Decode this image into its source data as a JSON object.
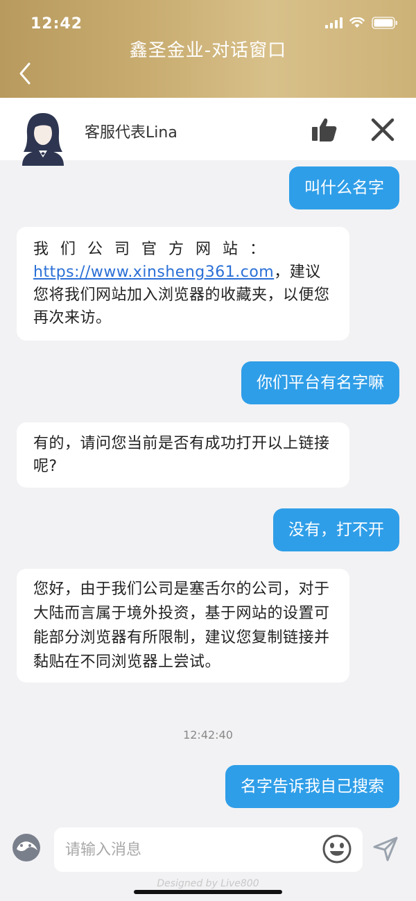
{
  "status_bar": {
    "time": "12:42"
  },
  "header": {
    "title": "鑫圣金业-对话窗口"
  },
  "agent": {
    "name": "客服代表Lina"
  },
  "messages": [
    {
      "from": "user",
      "text": "叫什么名字"
    },
    {
      "from": "agent",
      "text_before": "我们公司官方网站：",
      "link": "https://www.xinsheng361.com",
      "text_after": "，建议您将我们网站加入浏览器的收藏夹，以便您再次来访。"
    },
    {
      "from": "user",
      "text": "你们平台有名字嘛"
    },
    {
      "from": "agent",
      "text": "有的，请问您当前是否有成功打开以上链接呢?"
    },
    {
      "from": "user",
      "text": "没有，打不开"
    },
    {
      "from": "agent",
      "text": "您好，由于我们公司是塞舌尔的公司，对于大陆而言属于境外投资，基于网站的设置可能部分浏览器有所限制，建议您复制链接并黏贴在不同浏览器上尝试。"
    },
    {
      "from": "user",
      "text": "名字告诉我自己搜索"
    }
  ],
  "timestamp": "12:42:40",
  "input": {
    "placeholder": "请输入消息",
    "value": ""
  },
  "footer": {
    "brand": "Designed by Live800"
  },
  "colors": {
    "header_gold": "#c8ac70",
    "user_bubble": "#2f9ee8",
    "link": "#2a6fd6",
    "background": "#f2f2f4"
  },
  "icons": {
    "back": "chevron-left-icon",
    "like": "thumbs-up-icon",
    "close": "close-icon",
    "emoji": "smiley-icon",
    "send": "send-icon"
  }
}
